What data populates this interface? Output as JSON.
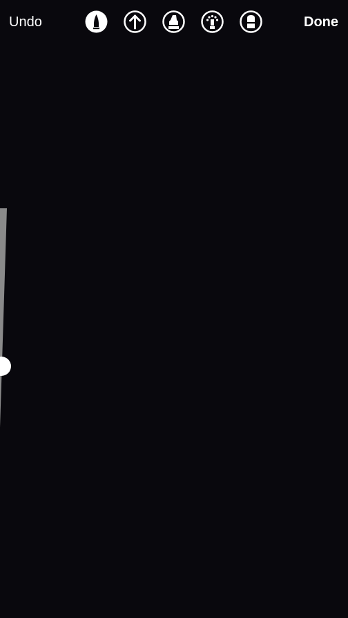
{
  "toolbar": {
    "undo_label": "Undo",
    "done_label": "Done",
    "tools": [
      {
        "name": "pen",
        "icon": "pen-icon",
        "selected": true
      },
      {
        "name": "arrow",
        "icon": "arrow-up-icon",
        "selected": false
      },
      {
        "name": "marker",
        "icon": "marker-icon",
        "selected": false
      },
      {
        "name": "neon",
        "icon": "neon-brush-icon",
        "selected": false
      },
      {
        "name": "eraser",
        "icon": "eraser-icon",
        "selected": false
      }
    ]
  },
  "brush_size_slider": {
    "level": 0.28
  },
  "colors": {
    "background": "#09080d",
    "foreground": "#ffffff",
    "slider_track": "#8a8a8a"
  }
}
